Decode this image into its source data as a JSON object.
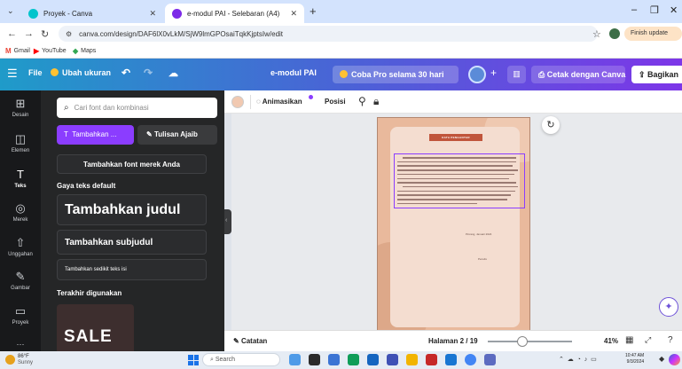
{
  "browser": {
    "tabs": [
      {
        "title": "Proyek - Canva",
        "active": false
      },
      {
        "title": "e-modul PAI - Selebaran (A4)",
        "active": true
      }
    ],
    "url": "canva.com/design/DAF6lX0vLkM/SjW9lmGPOsaiTqkKjptsIw/edit",
    "finish_update": "Finish update",
    "bookmarks": [
      "Gmail",
      "YouTube",
      "Maps"
    ]
  },
  "header": {
    "file": "File",
    "resize": "Ubah ukuran",
    "doc_title": "e-modul PAI",
    "pro_trial": "Coba Pro selama 30 hari",
    "print": "Cetak dengan Canva",
    "share": "Bagikan"
  },
  "rail": [
    {
      "label": "Desain",
      "icon": "layout-icon"
    },
    {
      "label": "Elemen",
      "icon": "shapes-icon"
    },
    {
      "label": "Teks",
      "icon": "text-icon"
    },
    {
      "label": "Merek",
      "icon": "brand-icon"
    },
    {
      "label": "Unggahan",
      "icon": "upload-icon"
    },
    {
      "label": "Gambar",
      "icon": "draw-icon"
    },
    {
      "label": "Proyek",
      "icon": "folder-icon"
    }
  ],
  "panel": {
    "search_placeholder": "Cari font dan kombinasi",
    "add_text": "Tambahkan ...",
    "magic_write": "Tulisan Ajaib",
    "brand_fonts": "Tambahkan font merek Anda",
    "default_styles_heading": "Gaya teks default",
    "heading": "Tambahkan judul",
    "subheading": "Tambahkan subjudul",
    "body": "Tambahkan sedikit teks isi",
    "recent_heading": "Terakhir digunakan",
    "recent_item": "SALE"
  },
  "toolbar": {
    "animate": "Animasikan",
    "position": "Posisi"
  },
  "page": {
    "title": "KATA PENGANTAR",
    "place_date": "Pinrang, Januari 2024",
    "signer": "Penulis"
  },
  "footer": {
    "notes": "Catatan",
    "page": "Halaman 2 / 19",
    "zoom": "41%",
    "zoom_fraction": 0.41
  },
  "taskbar": {
    "temp": "86°F",
    "condition": "Sunny",
    "search": "Search",
    "time": "10:47 AM",
    "date": "9/3/2024"
  },
  "colors": {
    "accent": "#8b3dff",
    "header_start": "#1f9bc9",
    "header_end": "#7d36e8",
    "page_bg": "#e9b99c"
  }
}
